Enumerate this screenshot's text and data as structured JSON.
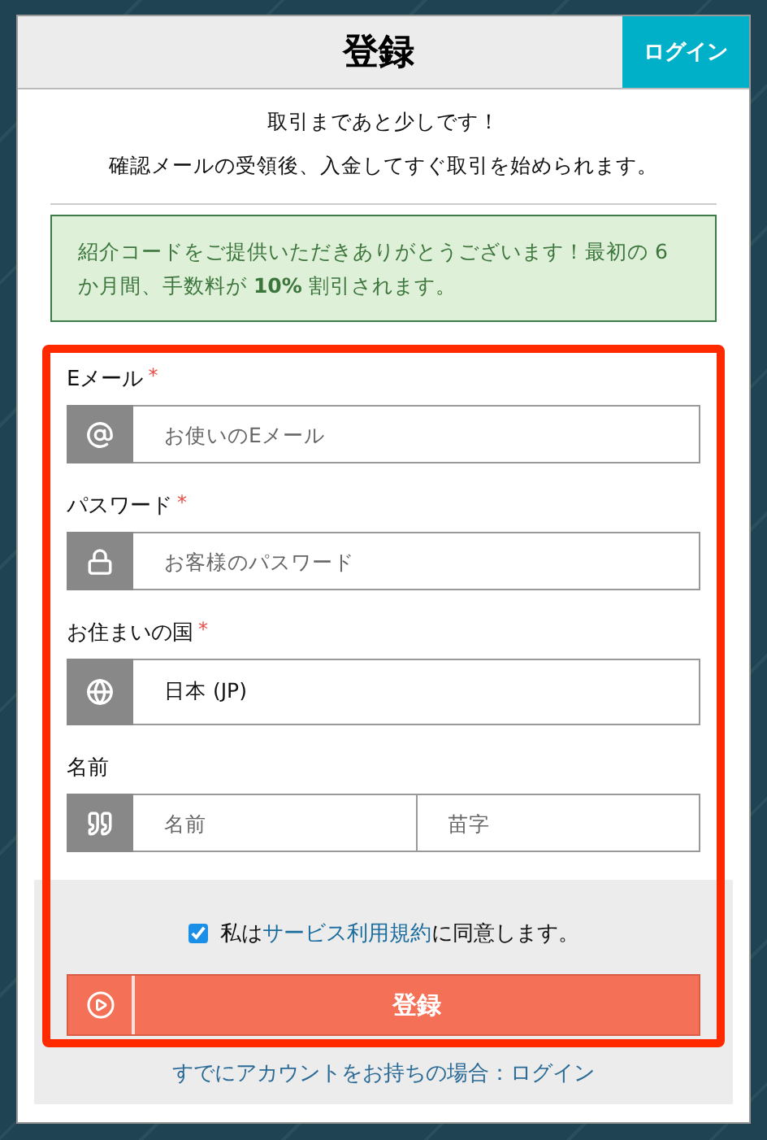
{
  "header": {
    "title": "登録",
    "login_button": "ログイン"
  },
  "intro": [
    "取引まであと少しです！",
    "確認メールの受領後、入金してすぐ取引を始められます。"
  ],
  "notice": "紹介コードをご提供いただきありがとうございます！最初の 6 か月間、手数料が **10%** 割引されます。",
  "fields": [
    {
      "kind": "email",
      "label": "Eメール",
      "required_mark": "*",
      "inputs": [
        {
          "placeholder": "お使いのEメール"
        }
      ]
    },
    {
      "kind": "password",
      "label": "パスワード",
      "required_mark": "*",
      "inputs": [
        {
          "placeholder": "お客様のパスワード"
        }
      ]
    },
    {
      "kind": "country",
      "label": "お住まいの国",
      "required_mark": "*",
      "inputs": [
        {
          "value": "日本 (JP)"
        }
      ]
    },
    {
      "kind": "name",
      "label": "名前",
      "inputs": [
        {
          "placeholder": "名前"
        },
        {
          "placeholder": "苗字"
        }
      ]
    }
  ],
  "terms": {
    "checked": true,
    "before": "私は",
    "link": "サービス利用規約",
    "after": "に同意します。"
  },
  "submit": "登録",
  "login_prompt": "すでにアカウントをお持ちの場合：ログイン"
}
